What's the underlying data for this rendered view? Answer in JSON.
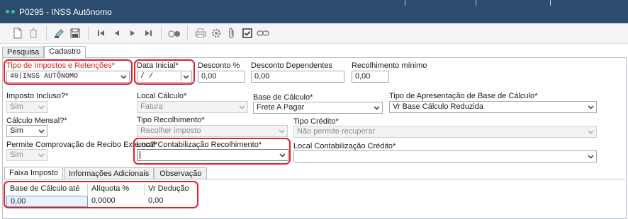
{
  "window": {
    "title": "P0295 - INSS Autônomo"
  },
  "toolbar": {
    "icons": [
      "new-icon",
      "delete-icon",
      "edit-icon",
      "save-icon",
      "first-icon",
      "prev-icon",
      "next-icon",
      "last-icon",
      "binoculars-icon",
      "print-icon",
      "gear-icon",
      "attach-icon",
      "checkbox-icon",
      "link-icon"
    ]
  },
  "tabs": {
    "pesquisa": "Pesquisa",
    "cadastro": "Cadastro"
  },
  "form": {
    "tipo_impostos": {
      "label": "Tipo de Impostos e Retenções*",
      "value": "40|INSS AUTÔNOMO"
    },
    "data_inicial": {
      "label": "Data Inicial*",
      "value": " / /"
    },
    "desconto": {
      "label": "Desconto %",
      "value": "0,00"
    },
    "desconto_dep": {
      "label": "Desconto Dependentes",
      "value": "0,00"
    },
    "recolhimento_min": {
      "label": "Recolhimento mínimo",
      "value": "0,00"
    },
    "imposto_incluso": {
      "label": "Imposto Incluso?*",
      "value": "Sim"
    },
    "local_calculo": {
      "label": "Local Cálculo*",
      "value": "Fatura"
    },
    "base_calculo": {
      "label": "Base de Cálculo*",
      "value": "Frete A Pagar"
    },
    "tipo_apresentacao": {
      "label": "Tipo de Apresentação de Base de Cálculo*",
      "value": "Vr Base Cálculo Reduzida"
    },
    "calculo_mensal": {
      "label": "Cálculo Mensal?*",
      "value": "Sim"
    },
    "tipo_recolhimento": {
      "label": "Tipo Recolhimento*",
      "value": "Recolher imposto"
    },
    "tipo_credito": {
      "label": "Tipo Crédito*",
      "value": "Não permite recuperar"
    },
    "permite_comprovacao": {
      "label": "Permite Comprovação de Recibo Externo?*",
      "value": "Sim"
    },
    "local_contab_recolhimento": {
      "label": "Local Contabilização Recolhimento*",
      "value": ""
    },
    "local_contab_credito": {
      "label": "Local Contabilização Crédito*",
      "value": ""
    }
  },
  "subtabs": {
    "faixa": "Faixa Imposto",
    "info": "Informações Adicionais",
    "obs": "Observação"
  },
  "grid": {
    "headers": [
      "Base de Cálculo até",
      "Alíquota %",
      "Vr Dedução"
    ],
    "rows": [
      [
        "0,00",
        "0,0000",
        "0,00"
      ]
    ]
  }
}
